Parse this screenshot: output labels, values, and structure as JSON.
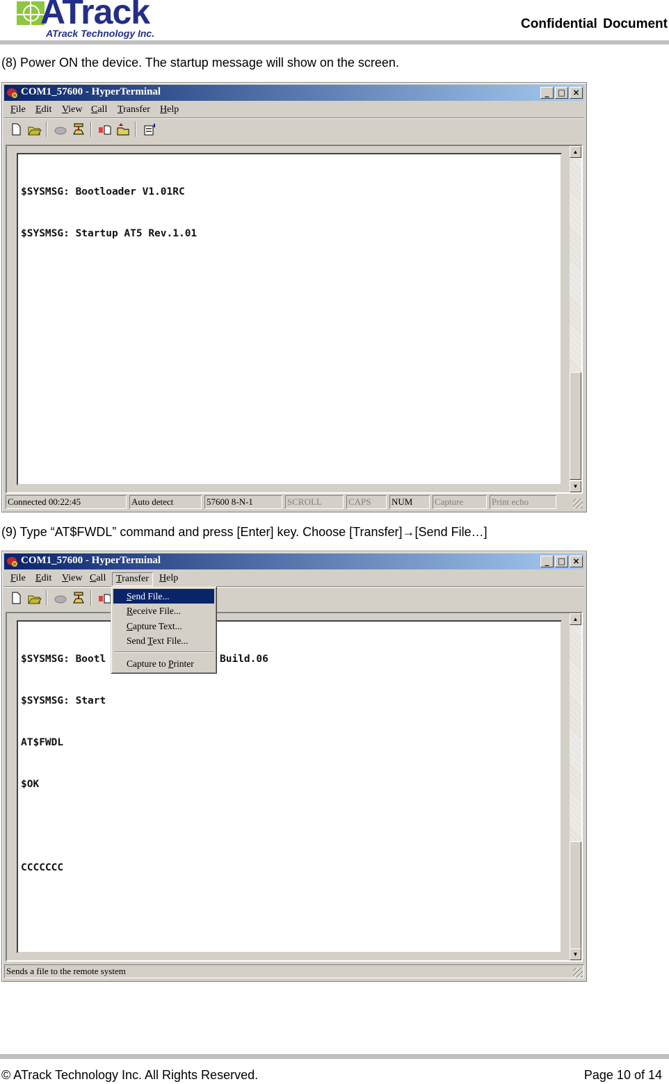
{
  "header": {
    "logo_word": "ATrack",
    "logo_subtitle": "ATrack Technology Inc.",
    "confidential": "Confidential  Document",
    "colors": {
      "logo_green": "#8dc63f",
      "logo_blue": "#232e86",
      "rule_gray": "#c0c0c0"
    }
  },
  "steps": [
    {
      "text": "(8) Power ON the device. The startup message will show on the screen."
    },
    {
      "text": "(9) Type “AT$FWDL” command and press [Enter] key. Choose [Transfer]→[Send File…]"
    }
  ],
  "window1": {
    "title": "COM1_57600 - HyperTerminal",
    "title_icon": "hyperterminal-phone-icon",
    "controls": {
      "minimize": "_",
      "maximize": "□",
      "close": "×"
    },
    "menu": [
      "File",
      "Edit",
      "View",
      "Call",
      "Transfer",
      "Help"
    ],
    "toolbar": [
      "new-document-icon",
      "open-folder-icon",
      "disconnect-phone-icon",
      "dial-phone-icon",
      "send-icon",
      "receive-icon",
      "properties-icon"
    ],
    "terminal_lines": [
      "$SYSMSG: Bootloader V1.01RC",
      "$SYSMSG: Startup AT5 Rev.1.01"
    ],
    "status": {
      "connected": "Connected 00:22:45",
      "detect": "Auto detect",
      "settings": "57600 8-N-1",
      "scroll": "SCROLL",
      "caps": "CAPS",
      "num": "NUM",
      "capture": "Capture",
      "print_echo": "Print echo"
    }
  },
  "window2": {
    "title": "COM1_57600 - HyperTerminal",
    "controls": {
      "minimize": "_",
      "maximize": "□",
      "close": "×"
    },
    "menu": [
      "File",
      "Edit",
      "View",
      "Call",
      "Transfer",
      "Help"
    ],
    "open_menu": "Transfer",
    "dropdown": [
      {
        "pre": "",
        "key": "S",
        "post": "end File...",
        "selected": true
      },
      {
        "pre": "",
        "key": "R",
        "post": "eceive File...",
        "selected": false
      },
      {
        "pre": "",
        "key": "C",
        "post": "apture Text...",
        "selected": false
      },
      {
        "pre": "Send ",
        "key": "T",
        "post": "ext File...",
        "selected": false
      },
      {
        "pre": "Capture to ",
        "key": "P",
        "post": "rinter",
        "selected": false
      }
    ],
    "terminal_lines": [
      {
        "left": "$SYSMSG: Bootl",
        "right": "Build.06"
      },
      {
        "left": "$SYSMSG: Start",
        "right": ""
      },
      {
        "left": "AT$FWDL",
        "right": ""
      },
      {
        "left": "$OK",
        "right": ""
      },
      {
        "left": "",
        "right": ""
      },
      {
        "left": "CCCCCCC",
        "right": ""
      }
    ],
    "status_text": "Sends a file to the remote system",
    "highlight_color": "#0a246a"
  },
  "footer": {
    "copyright": "© ATrack Technology Inc. All Rights Reserved.",
    "page": "Page 10 of 14"
  }
}
